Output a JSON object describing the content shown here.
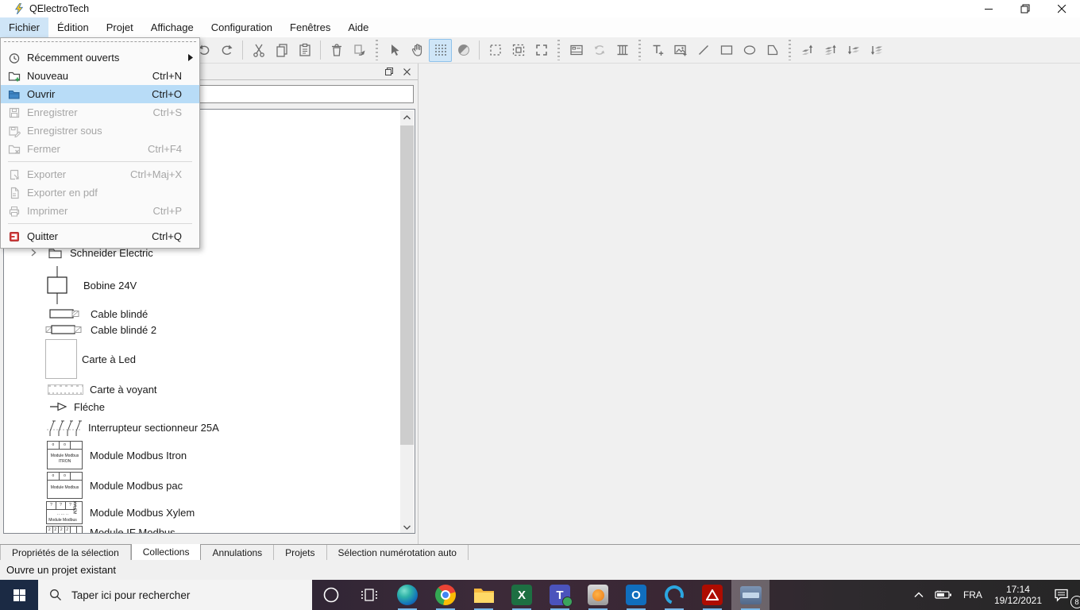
{
  "titlebar": {
    "title": "QElectroTech"
  },
  "menubar": {
    "items": [
      {
        "label": "Fichier"
      },
      {
        "label": "Édition"
      },
      {
        "label": "Projet"
      },
      {
        "label": "Affichage"
      },
      {
        "label": "Configuration"
      },
      {
        "label": "Fenêtres"
      },
      {
        "label": "Aide"
      }
    ]
  },
  "file_menu": {
    "items": [
      {
        "label": "Récemment ouverts",
        "shortcut": ""
      },
      {
        "label": "Nouveau",
        "shortcut": "Ctrl+N"
      },
      {
        "label": "Ouvrir",
        "shortcut": "Ctrl+O"
      },
      {
        "label": "Enregistrer",
        "shortcut": "Ctrl+S"
      },
      {
        "label": "Enregistrer sous",
        "shortcut": ""
      },
      {
        "label": "Fermer",
        "shortcut": "Ctrl+F4"
      },
      {
        "label": "Exporter",
        "shortcut": "Ctrl+Maj+X"
      },
      {
        "label": "Exporter en pdf",
        "shortcut": ""
      },
      {
        "label": "Imprimer",
        "shortcut": "Ctrl+P"
      },
      {
        "label": "Quitter",
        "shortcut": "Ctrl+Q"
      }
    ]
  },
  "toolbar": {
    "icons": [
      "undo",
      "redo",
      "cut",
      "copy",
      "paste",
      "delete",
      "transform",
      "selection-pointer",
      "pan-hand",
      "grid",
      "antialiasing",
      "select-dashed",
      "select-dashed-filled",
      "select-corners",
      "titleblock",
      "rotate",
      "column",
      "add-text",
      "add-image",
      "draw-line",
      "draw-rectangle",
      "draw-ellipse",
      "draw-polygon",
      "raise-layer",
      "raise-to-top",
      "lower-layer",
      "lower-to-bottom"
    ],
    "active_icon": "grid"
  },
  "dock": {
    "tree": {
      "folder": {
        "label": "Schneider Electric"
      },
      "items": [
        {
          "label": "Bobine 24V"
        },
        {
          "label": "Cable blindé"
        },
        {
          "label": "Cable blindé 2"
        },
        {
          "label": "Carte à Led"
        },
        {
          "label": "Carte à voyant"
        },
        {
          "label": "Fléche"
        },
        {
          "label": "Interrupteur sectionneur 25A"
        },
        {
          "label": "Module Modbus Itron",
          "symbol_line1": "Module Modbus",
          "symbol_line2": "ITRON"
        },
        {
          "label": "Module Modbus pac",
          "symbol_line1": "Module Modbus"
        },
        {
          "label": "Module Modbus Xylem",
          "symbol_line1": "Module Modbus",
          "symbol_line2": "XYLEM"
        },
        {
          "label": "Module IF Modbus"
        }
      ]
    },
    "tabs": [
      {
        "label": "Propriétés de la sélection"
      },
      {
        "label": "Collections"
      },
      {
        "label": "Annulations"
      },
      {
        "label": "Projets"
      },
      {
        "label": "Sélection numérotation auto"
      }
    ],
    "active_tab": "Collections"
  },
  "statusbar": {
    "text": "Ouvre un projet existant"
  },
  "taskbar": {
    "search_placeholder": "Taper ici pour rechercher",
    "language": "FRA",
    "time": "17:14",
    "date": "19/12/2021",
    "notification_count": "8"
  },
  "colors": {
    "menu_highlight": "#b8dcf7",
    "menubar_highlight": "#cfe5f7",
    "toolbar_active_bg": "#cfe6f8",
    "taskbar_underline": "#79b8e8",
    "open_folder_blue": "#3f86c6",
    "quit_red": "#d23c3c"
  }
}
